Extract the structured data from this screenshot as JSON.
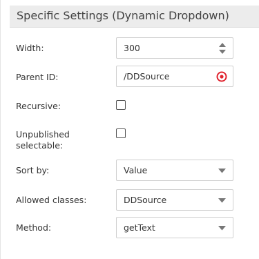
{
  "panel": {
    "title": "Specific Settings (Dynamic Dropdown)"
  },
  "fields": {
    "width": {
      "label": "Width:",
      "value": "300",
      "icon": "spinner-icon"
    },
    "parent_id": {
      "label": "Parent ID:",
      "value": "/DDSource",
      "icon": "target-icon",
      "icon_color": "#e0232e"
    },
    "recursive": {
      "label": "Recursive:",
      "checked": false
    },
    "unpublished": {
      "label_line1": "Unpublished",
      "label_line2": "selectable:",
      "checked": false
    },
    "sort_by": {
      "label": "Sort by:",
      "value": "Value",
      "icon": "chevron-down-icon"
    },
    "allowed_classes": {
      "label": "Allowed classes:",
      "value": "DDSource",
      "icon": "chevron-down-icon"
    },
    "method": {
      "label": "Method:",
      "value": "getText",
      "icon": "chevron-down-icon"
    }
  }
}
